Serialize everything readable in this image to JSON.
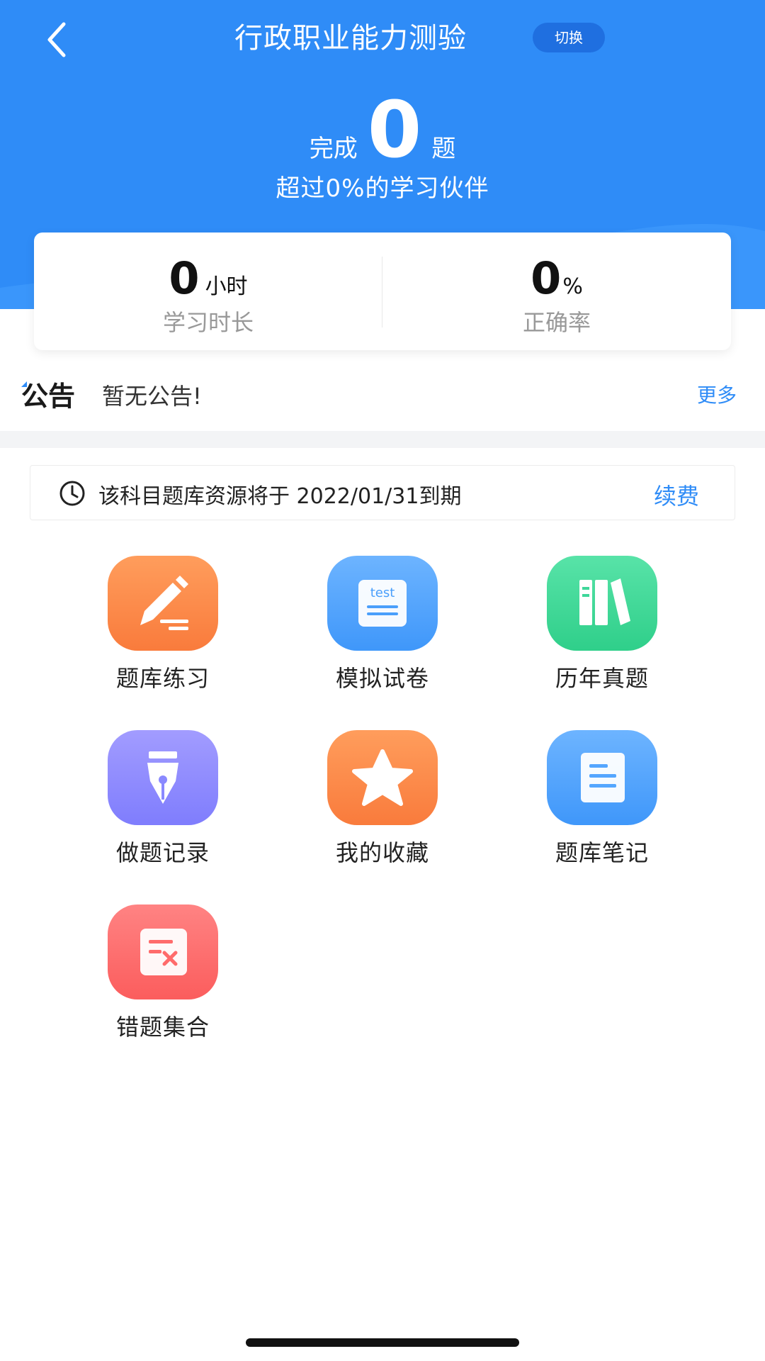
{
  "header": {
    "title": "行政职业能力测验",
    "switch_label": "切换",
    "done_label": "完成",
    "done_count": "0",
    "done_unit": "题",
    "exceed_text": "超过0%的学习伙伴",
    "background_color": "#2f8cf7"
  },
  "stats": {
    "study_time": {
      "value": "0",
      "unit": "小时",
      "label": "学习时长"
    },
    "accuracy": {
      "value": "0",
      "unit": "%",
      "label": "正确率"
    }
  },
  "notice": {
    "logo_text": "公告",
    "text": "暂无公告!",
    "more_label": "更多"
  },
  "expire": {
    "message": "该科目题库资源将于 2022/01/31到期",
    "renew_label": "续费"
  },
  "features": [
    {
      "id": "practice",
      "label": "题库练习",
      "icon": "pencil-icon",
      "color": "#fb8c4e"
    },
    {
      "id": "mock",
      "label": "模拟试卷",
      "icon": "test-paper-icon",
      "color": "#54a6ff",
      "icon_text": "test"
    },
    {
      "id": "past",
      "label": "历年真题",
      "icon": "books-icon",
      "color": "#3ed79a"
    },
    {
      "id": "record",
      "label": "做题记录",
      "icon": "fountain-pen-icon",
      "color": "#8a89ff"
    },
    {
      "id": "favorites",
      "label": "我的收藏",
      "icon": "star-icon",
      "color": "#fb8c4e"
    },
    {
      "id": "notes",
      "label": "题库笔记",
      "icon": "notes-icon",
      "color": "#54a6ff"
    },
    {
      "id": "mistakes",
      "label": "错题集合",
      "icon": "wrong-answer-icon",
      "color": "#ff6b6b"
    }
  ]
}
